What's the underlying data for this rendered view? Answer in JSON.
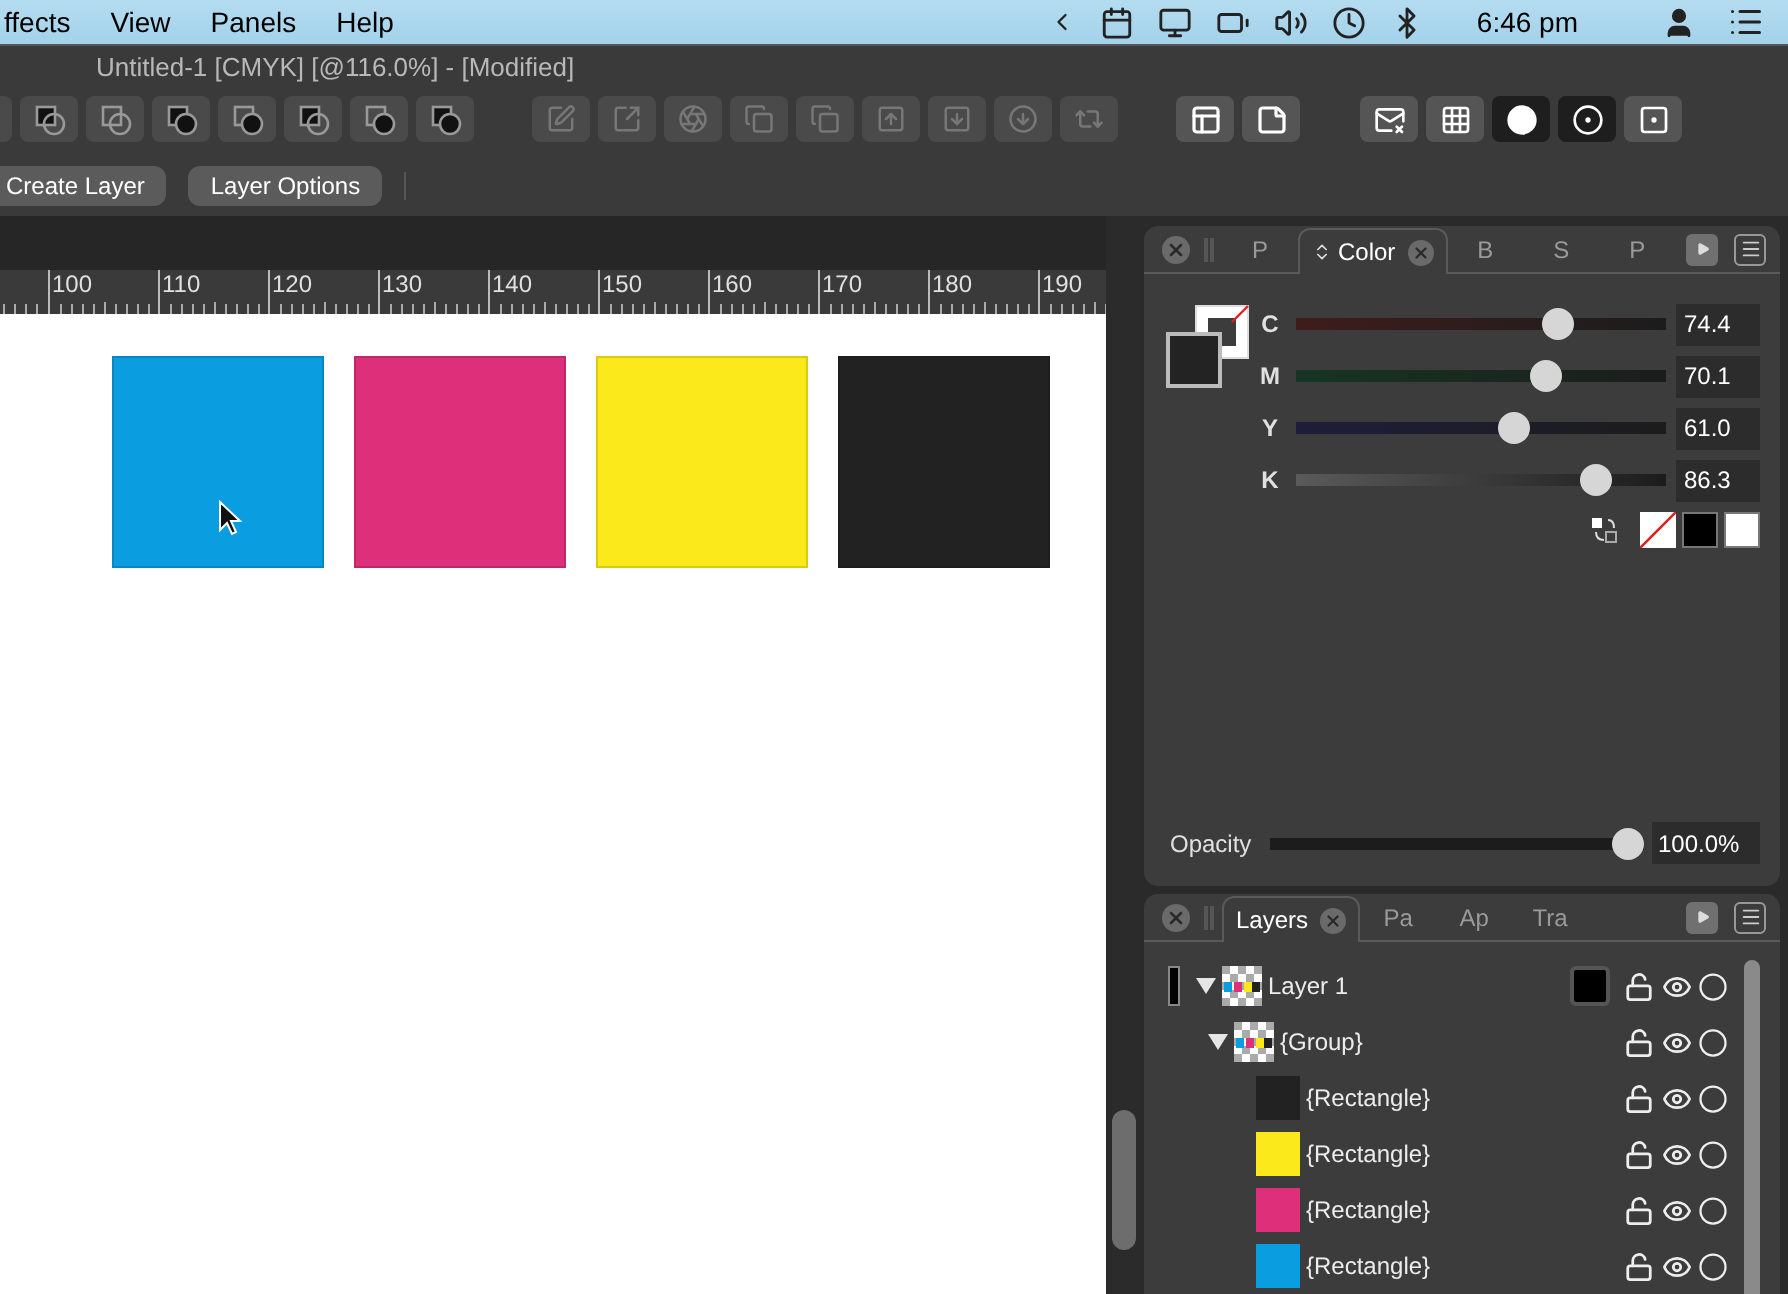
{
  "menu_bar": {
    "items": [
      {
        "label": "ffects"
      },
      {
        "label": "View"
      },
      {
        "label": "Panels"
      },
      {
        "label": "Help"
      }
    ],
    "time": "6:46 pm"
  },
  "window": {
    "title": "Untitled-1 [CMYK] [@116.0%] - [Modified]"
  },
  "view_toggles": [
    {
      "selected": false
    },
    {
      "selected": false
    },
    {
      "selected": true
    },
    {
      "selected": true
    },
    {
      "selected": false
    }
  ],
  "layer_buttons": [
    "Create Layer",
    "Layer Options"
  ],
  "ruler": {
    "labels": [
      "100",
      "110",
      "120",
      "130",
      "140",
      "150",
      "160",
      "170",
      "180",
      "190"
    ]
  },
  "canvas": {
    "shapes": [
      {
        "color": "#0a9de0"
      },
      {
        "color": "#de2f7b"
      },
      {
        "color": "#fbe91b"
      },
      {
        "color": "#222222"
      }
    ]
  },
  "color_panel": {
    "tabs": [
      {
        "label": "P",
        "selected": false,
        "has_menu": false
      },
      {
        "label": "Color",
        "selected": true,
        "has_menu": true
      },
      {
        "label": "B",
        "selected": false,
        "has_menu": false
      },
      {
        "label": "S",
        "selected": false,
        "has_menu": false
      },
      {
        "label": "P",
        "selected": false,
        "has_menu": false
      }
    ],
    "fill": {
      "color": "#232323"
    },
    "sliders": [
      {
        "label": "C",
        "color": "#3f1c1c",
        "level": 0.73,
        "reading": "74.4"
      },
      {
        "label": "M",
        "color": "#163524",
        "level": 0.69,
        "reading": "70.1"
      },
      {
        "label": "Y",
        "color": "#1d1d3a",
        "level": 0.6,
        "reading": "61.0"
      },
      {
        "label": "K",
        "color": "#5a5a5a",
        "level": 0.84,
        "reading": "86.3"
      }
    ],
    "quick_swatches": [
      {
        "kind": "none"
      },
      {
        "kind": "solid",
        "color": "#000000"
      },
      {
        "kind": "solid",
        "color": "#ffffff"
      }
    ],
    "opacity": {
      "label": "Opacity",
      "level": 1,
      "reading": "100.0%"
    }
  },
  "layers_panel": {
    "tabs": [
      {
        "label": "Layers",
        "selected": true
      },
      {
        "label": "Pa",
        "selected": false
      },
      {
        "label": "Ap",
        "selected": false
      },
      {
        "label": "Tra",
        "selected": false
      }
    ],
    "layers": [
      {
        "kind": "layer",
        "name": "Layer 1",
        "color": "#000000",
        "expanded": true,
        "children": [
          {
            "kind": "group",
            "name": "{Group}",
            "expanded": true,
            "children": [
              {
                "kind": "rectangle",
                "name": "{Rectangle}",
                "color": "#222222"
              },
              {
                "kind": "rectangle",
                "name": "{Rectangle}",
                "color": "#fbe91b"
              },
              {
                "kind": "rectangle",
                "name": "{Rectangle}",
                "color": "#de2f7b"
              },
              {
                "kind": "rectangle",
                "name": "{Rectangle}",
                "color": "#0a9de0"
              }
            ]
          }
        ]
      }
    ]
  }
}
